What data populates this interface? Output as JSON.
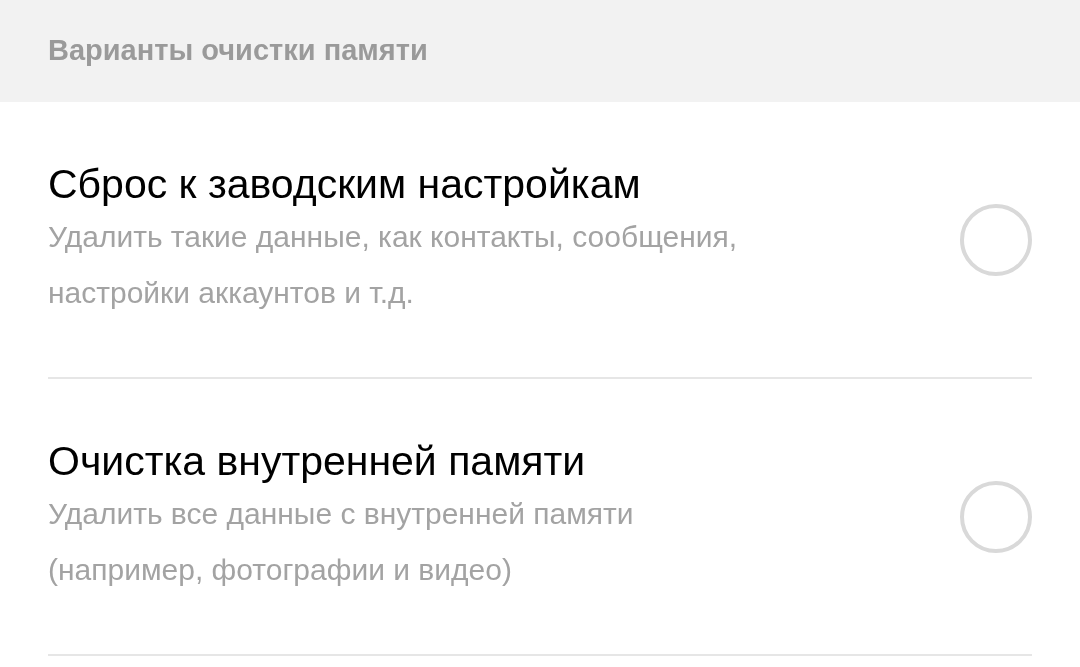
{
  "section_header": "Варианты очистки памяти",
  "options": [
    {
      "title": "Сброс к заводским настройкам",
      "description": "Удалить такие данные, как контакты, сообщения, настройки аккаунтов и т.д.",
      "selected": false
    },
    {
      "title": "Очистка внутренней памяти",
      "description": "Удалить все данные с внутренней памяти (например, фотографии и видео)",
      "selected": false
    }
  ]
}
